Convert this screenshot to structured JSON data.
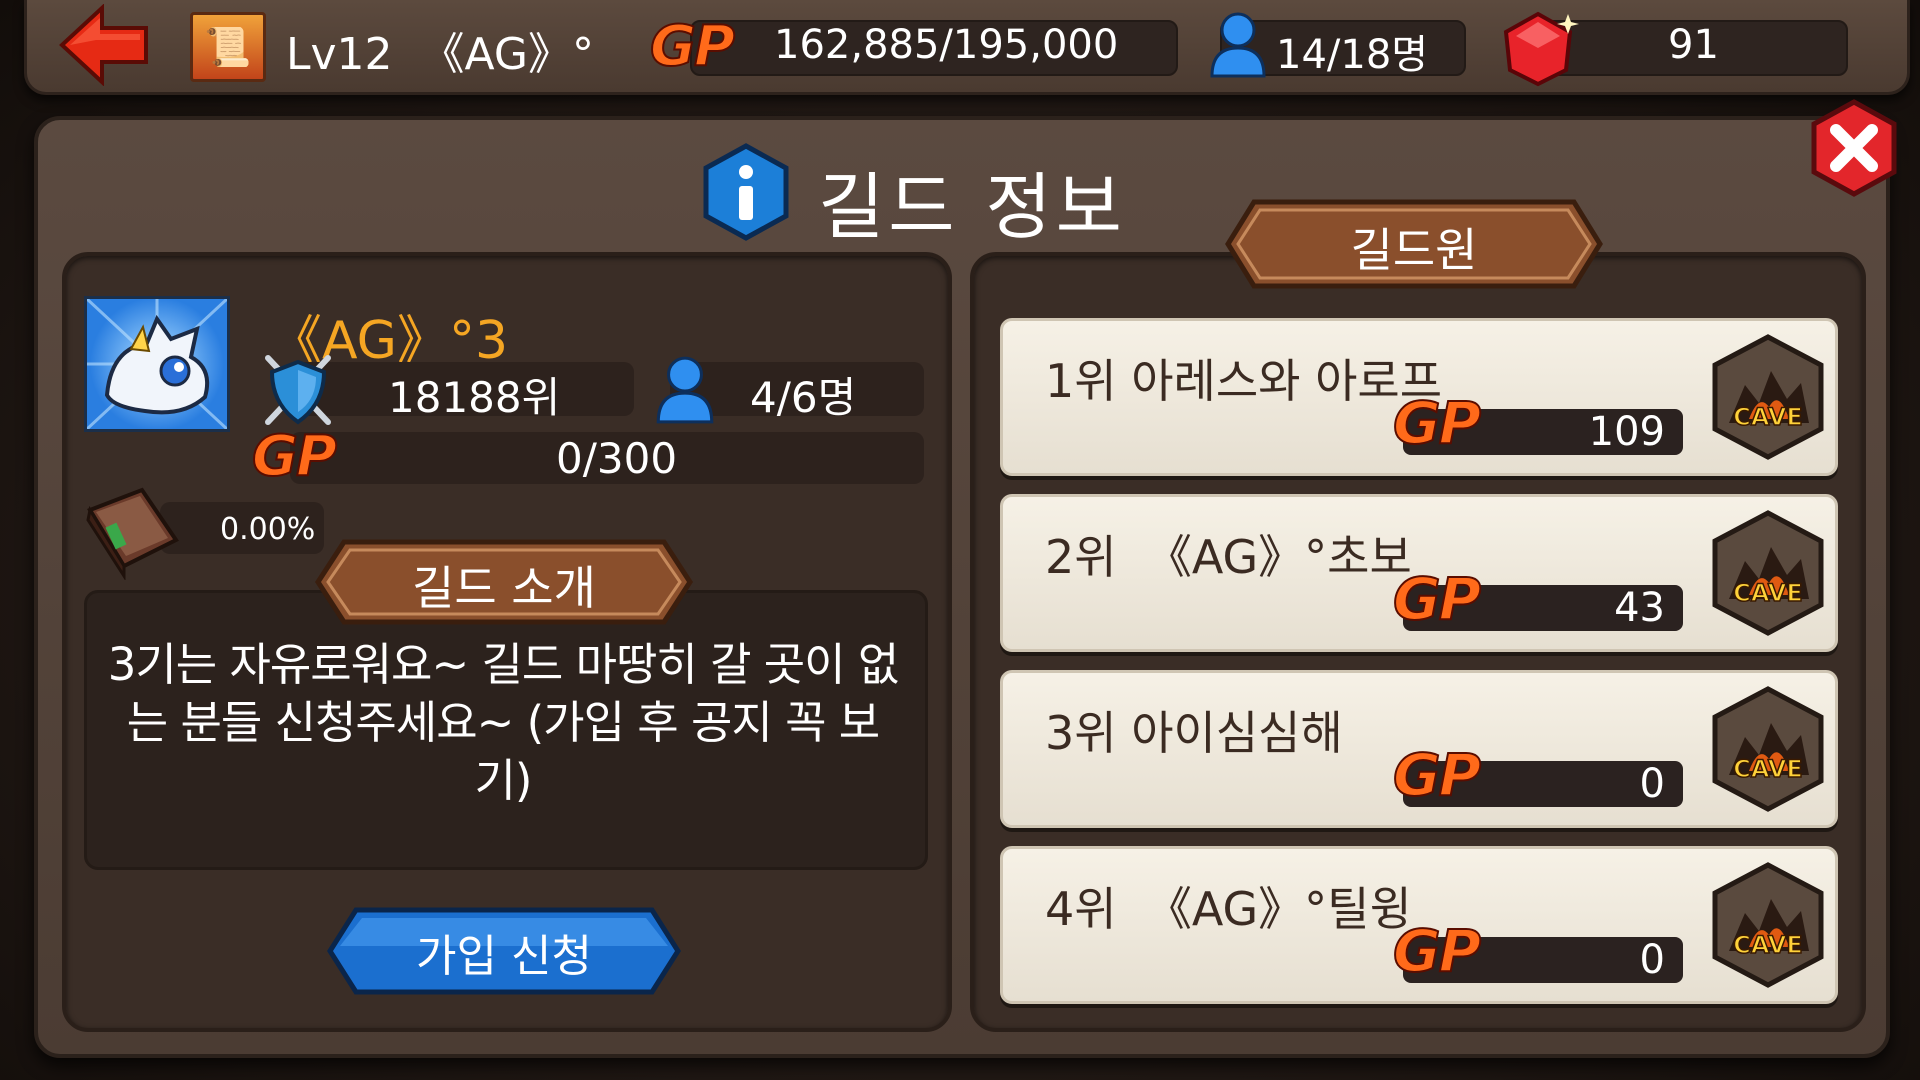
{
  "topbar": {
    "level": "Lv12",
    "player_name": "《AG》°",
    "gp_badge": "GP",
    "gp_value": "162,885/195,000",
    "members": "14/18명",
    "gems": "91"
  },
  "dialog": {
    "title": "길드 정보",
    "members_tab": "길드원",
    "intro_tab": "길드 소개",
    "join_button": "가입 신청"
  },
  "guild": {
    "name": "《AG》°3",
    "rank": "18188위",
    "members": "4/6명",
    "gp_badge": "GP",
    "gp": "0/300",
    "exp": "0.00%",
    "intro": "3기는 자유로워요~ 길드 마땅히 갈 곳이 없는 분들 신청주세요~ (가입 후 공지 꼭 보기)"
  },
  "member_list": [
    {
      "name": "1위 아레스와 아로프",
      "gp_badge": "GP",
      "gp": "109",
      "badge": "CAVE"
    },
    {
      "name": "2위  《AG》°초보",
      "gp_badge": "GP",
      "gp": "43",
      "badge": "CAVE"
    },
    {
      "name": "3위 아이심심해",
      "gp_badge": "GP",
      "gp": "0",
      "badge": "CAVE"
    },
    {
      "name": "4위  《AG》°틸윙",
      "gp_badge": "GP",
      "gp": "0",
      "badge": "CAVE"
    }
  ],
  "colors": {
    "gp_orange": "#ff6a1a",
    "guild_name": "#f5a623",
    "join_blue": "#1b6fcf",
    "wood": "#8a4f2c"
  }
}
